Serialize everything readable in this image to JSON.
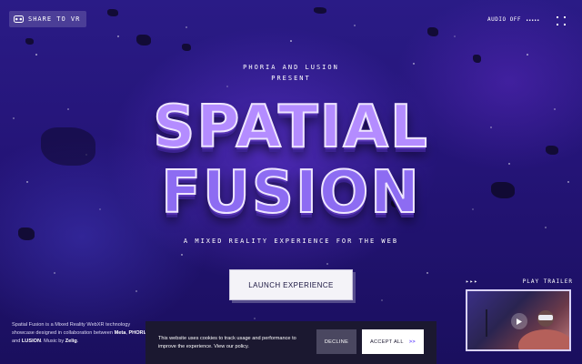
{
  "header": {
    "vr_label": "SHARE TO VR",
    "audio_label": "AUDIO OFF"
  },
  "hero": {
    "presenter_line1": "PHORIA AND LUSION",
    "presenter_line2": "PRESENT",
    "title_line1": "SPATIAL",
    "title_line2": "FUSION",
    "tagline": "A MIXED REALITY EXPERIENCE FOR THE WEB",
    "cta_label": "LAUNCH EXPERIENCE"
  },
  "trailer": {
    "arrows": "▸▸▸",
    "label": "PLAY TRAILER"
  },
  "description": {
    "part1": "Spatial Fusion is a Mixed Reality WebXR technology showcase designed in collaboration between ",
    "meta": "Meta",
    "sep1": ", ",
    "phoria": "PHORIA",
    "sep2": " and ",
    "lusion": "LUSION",
    "part2": ". Music by ",
    "zelig": "Zelig",
    "end": "."
  },
  "cookie": {
    "text": "This website uses cookies to track usage and performance to improve the experience. View our policy.",
    "decline_label": "DECLINE",
    "accept_label": "ACCEPT ALL",
    "accept_arrow": ">>"
  },
  "colors": {
    "background": "#241477",
    "title_fill": "#b48cff",
    "cookie_bg": "#1b1830",
    "accent": "#6a4cff"
  }
}
